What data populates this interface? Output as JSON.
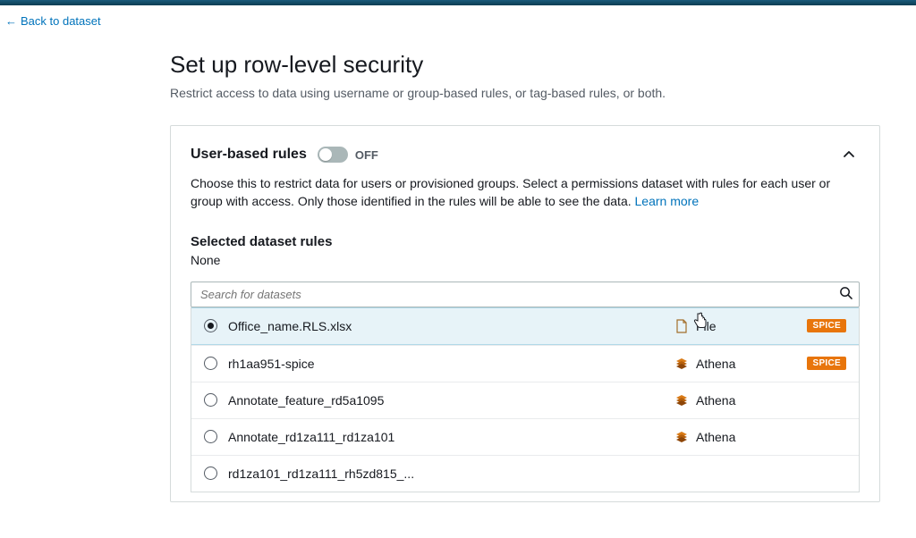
{
  "nav": {
    "back_label": "Back to dataset"
  },
  "header": {
    "title": "Set up row-level security",
    "subtitle": "Restrict access to data using username or group-based rules, or tag-based rules, or both."
  },
  "user_rules": {
    "title": "User-based rules",
    "toggle_state": "OFF",
    "description_prefix": "Choose this to restrict data for users or provisioned groups. Select a permissions dataset with rules for each user or group with access. Only those identified in the rules will be able to see the data. ",
    "learn_more": "Learn more"
  },
  "selected_rules": {
    "heading": "Selected dataset rules",
    "value": "None"
  },
  "search": {
    "placeholder": "Search for datasets"
  },
  "spice_label": "SPICE",
  "datasets": [
    {
      "name": "Office_name.RLS.xlsx",
      "source": "File",
      "source_icon": "file",
      "spice": true,
      "selected": true
    },
    {
      "name": "rh1aa951-spice",
      "source": "Athena",
      "source_icon": "athena",
      "spice": true,
      "selected": false
    },
    {
      "name": "Annotate_feature_rd5a1095",
      "source": "Athena",
      "source_icon": "athena",
      "spice": false,
      "selected": false
    },
    {
      "name": "Annotate_rd1za111_rd1za101",
      "source": "Athena",
      "source_icon": "athena",
      "spice": false,
      "selected": false
    },
    {
      "name": "rd1za101_rd1za111_rh5zd815_...",
      "source": "",
      "source_icon": "",
      "spice": false,
      "selected": false
    }
  ]
}
